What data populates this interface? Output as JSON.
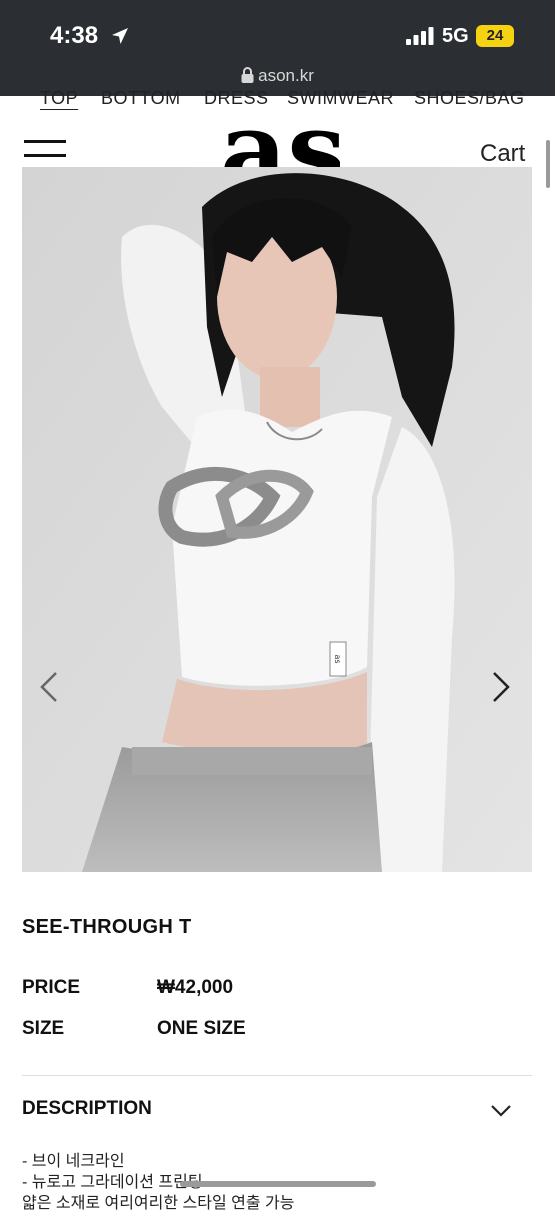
{
  "status_bar": {
    "time": "4:38",
    "network": "5G",
    "battery": "24",
    "url": "ason.kr",
    "icons": [
      "location-arrow-icon",
      "signal-bars-icon",
      "lock-icon"
    ]
  },
  "category_nav": [
    "TOP",
    "BOTTOM",
    "DRESS",
    "SWIMWEAR",
    "SHOES/BAG"
  ],
  "header": {
    "logo_text": "as",
    "cart_label": "Cart",
    "menu_icon": "hamburger-menu-icon"
  },
  "gallery": {
    "prev_icon": "chevron-left-icon",
    "next_icon": "chevron-right-icon",
    "tag_text": "as"
  },
  "product": {
    "title": "SEE-THROUGH T",
    "price_label": "PRICE",
    "price_value": "₩42,000",
    "size_label": "SIZE",
    "size_value": "ONE SIZE"
  },
  "description": {
    "title": "DESCRIPTION",
    "chevron_icon": "chevron-down-icon",
    "lines": [
      "- 브이 네크라인",
      "- 뉴로고 그라데이션 프린팅",
      "얇은 소재로 여리여리한 스타일 연출 가능"
    ]
  },
  "colors": {
    "status_bg": "#2b2f33",
    "battery": "#f5d313",
    "text": "#111111"
  }
}
